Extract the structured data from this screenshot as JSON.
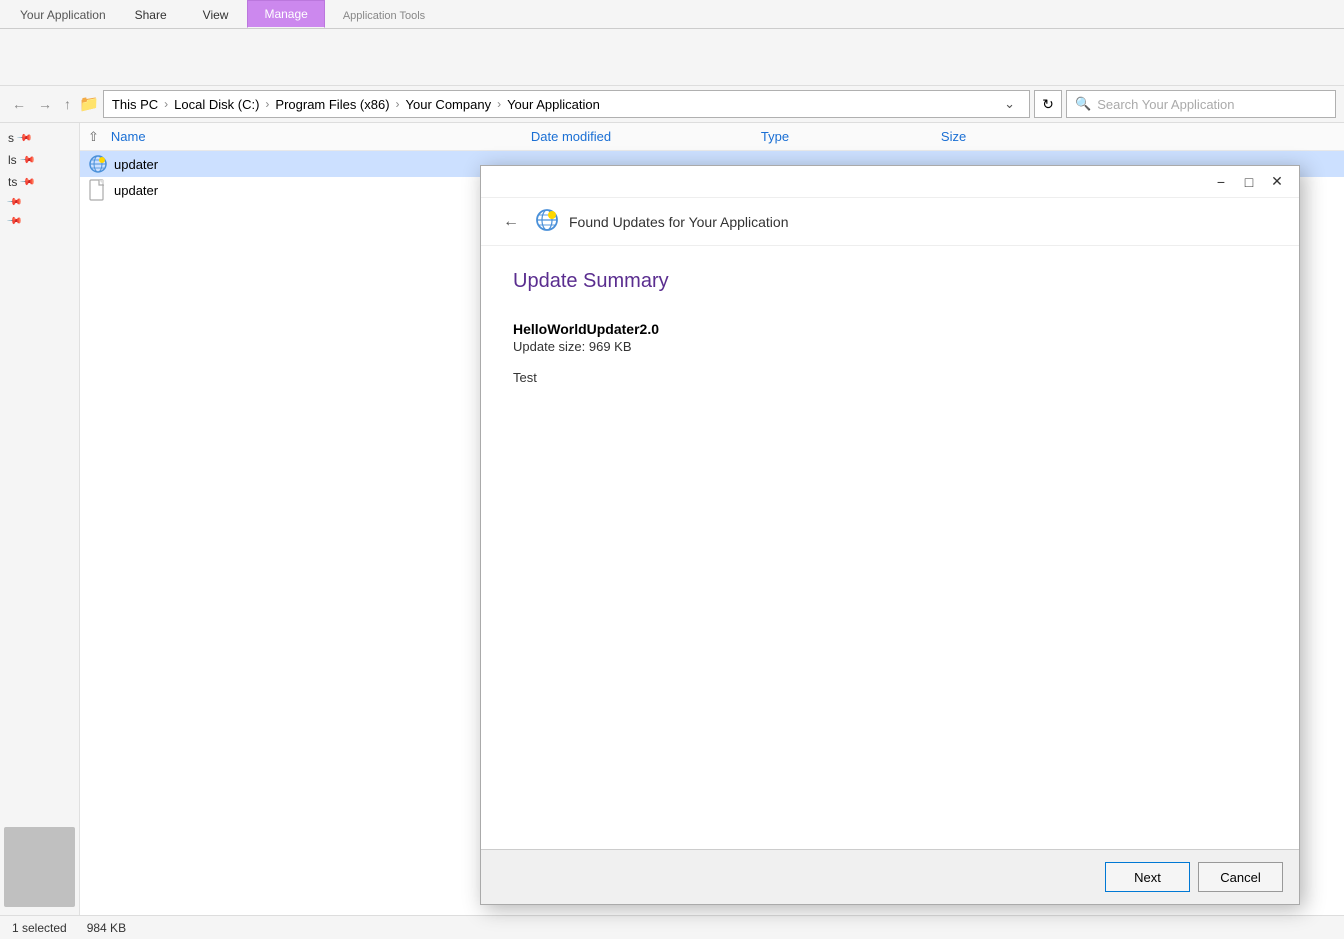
{
  "ribbon": {
    "app_tab": "Your Application",
    "tabs": [
      {
        "label": "Share",
        "active": false
      },
      {
        "label": "View",
        "active": false
      },
      {
        "label": "Manage",
        "active": true
      }
    ],
    "tools_label": "Application Tools"
  },
  "address_bar": {
    "breadcrumbs": [
      {
        "label": "This PC"
      },
      {
        "label": "Local Disk (C:)"
      },
      {
        "label": "Program Files (x86)"
      },
      {
        "label": "Your Company"
      },
      {
        "label": "Your Application"
      }
    ],
    "search_placeholder": "Search Your Application"
  },
  "columns": {
    "name": "Name",
    "date_modified": "Date modified",
    "type": "Type",
    "size": "Size"
  },
  "files": [
    {
      "name": "updater",
      "type": "folder",
      "selected": true
    },
    {
      "name": "updater",
      "type": "file",
      "selected": false
    }
  ],
  "sidebar": {
    "items": [
      {
        "label": "s"
      },
      {
        "label": "ls"
      },
      {
        "label": "ts"
      },
      {
        "label": ""
      },
      {
        "label": ""
      }
    ]
  },
  "status_bar": {
    "selection_text": "1 selected",
    "size_text": "984 KB"
  },
  "dialog": {
    "header_title": "Found Updates for Your Application",
    "back_icon": "←",
    "minimize_icon": "−",
    "maximize_icon": "□",
    "close_icon": "✕",
    "body": {
      "title": "Update Summary",
      "update_name": "HelloWorldUpdater2.0",
      "update_size_label": "Update size: 969 KB",
      "update_desc": "Test"
    },
    "footer": {
      "next_label": "Next",
      "cancel_label": "Cancel"
    }
  }
}
